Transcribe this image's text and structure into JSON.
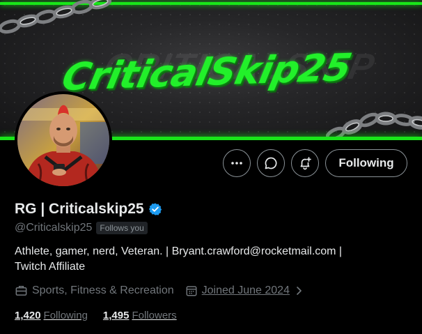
{
  "banner": {
    "brand_text": "CriticalSkip25",
    "ghost_text": "CRITICALSKIP"
  },
  "actions": {
    "more_icon": "more-horizontal-icon",
    "message_icon": "message-bubble-icon",
    "notify_icon": "bell-plus-icon",
    "following_label": "Following"
  },
  "profile": {
    "display_name": "RG | Criticalskip25",
    "verified": true,
    "handle": "@Criticalskip25",
    "follows_you": "Follows you",
    "bio_line1": "Athlete, gamer, nerd, Veteran. | Bryant.crawford@rocketmail.com |",
    "bio_line2": "Twitch Affiliate",
    "category": "Sports, Fitness & Recreation",
    "joined": "Joined June 2024",
    "following_count": "1,420",
    "following_label": "Following",
    "followers_count": "1,495",
    "followers_label": "Followers"
  },
  "colors": {
    "accent_green": "#19e619",
    "verified_blue": "#1d9bf0",
    "muted_text": "#71767b"
  }
}
